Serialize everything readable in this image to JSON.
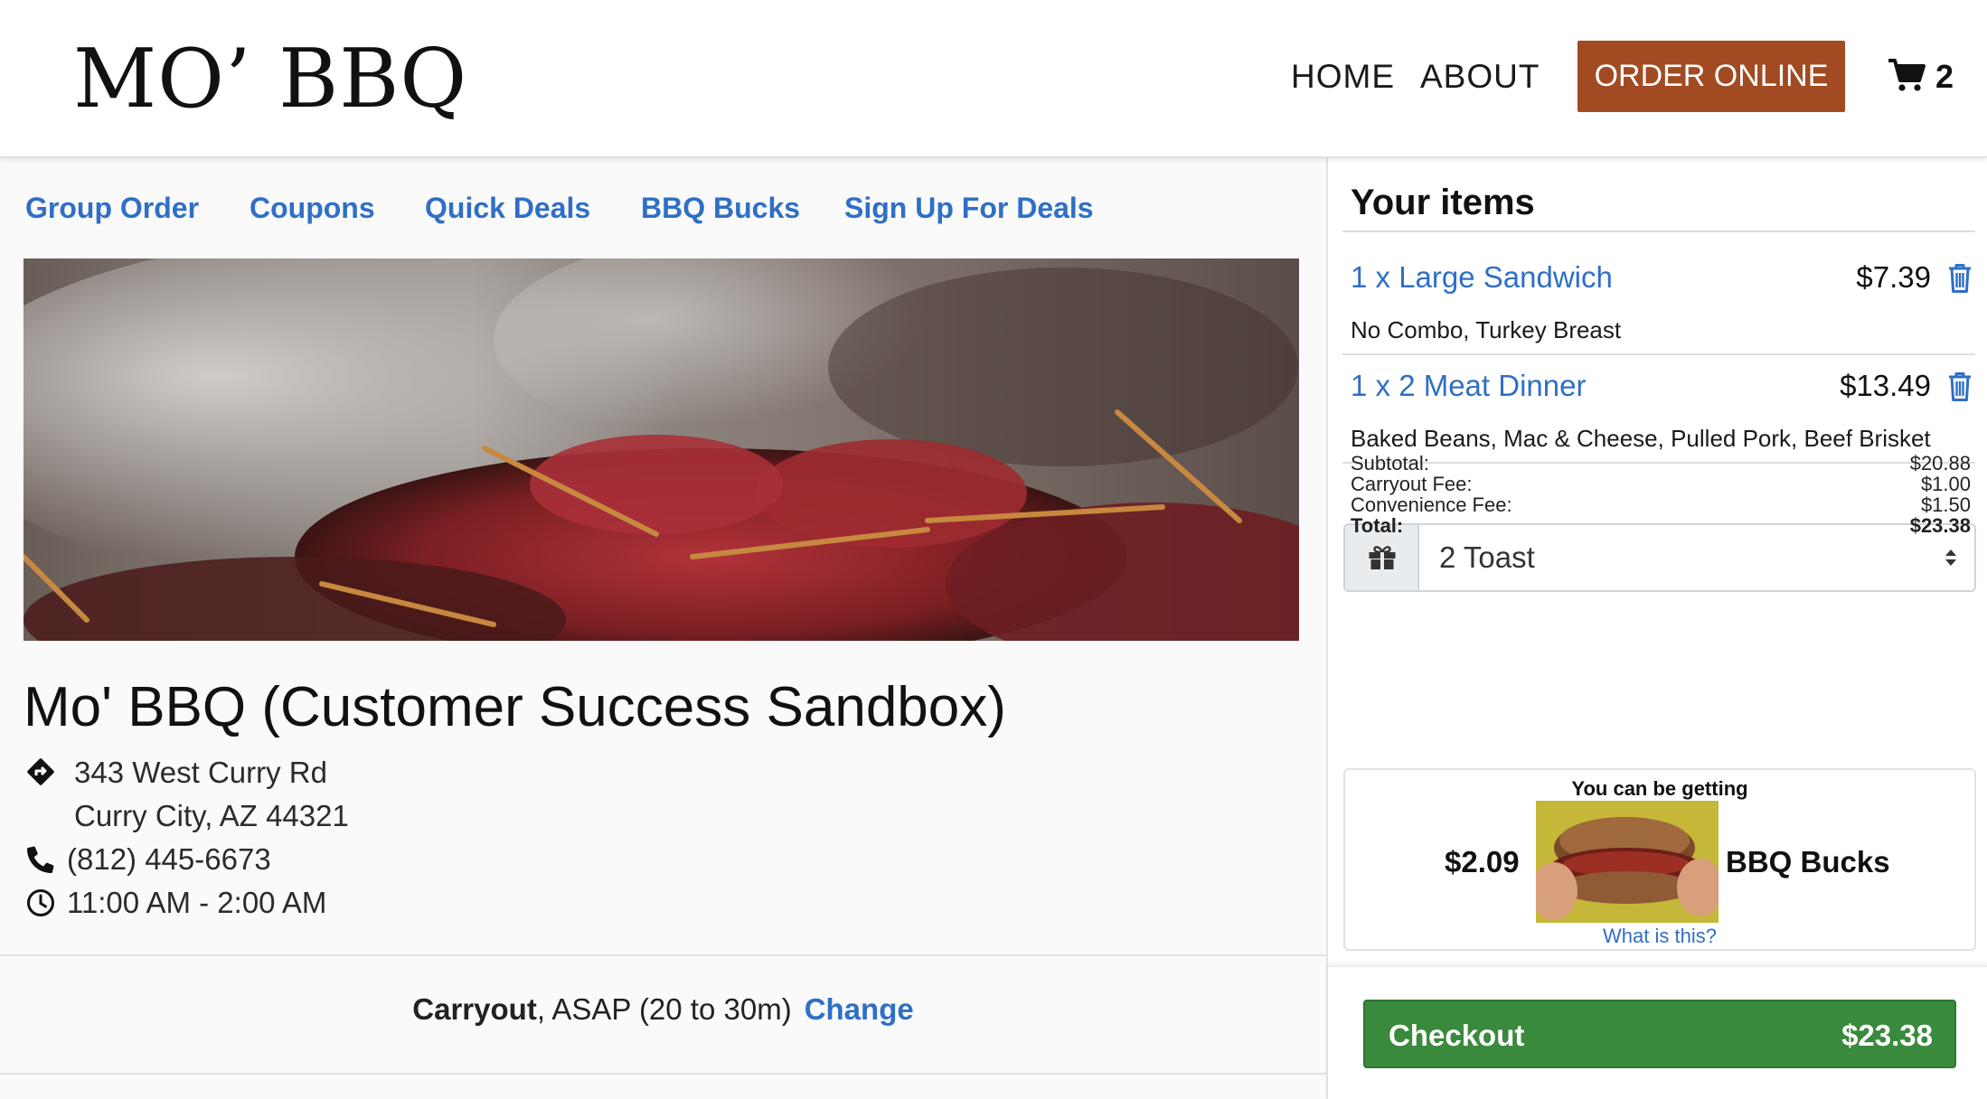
{
  "header": {
    "logo": "MO’ BBQ",
    "nav": {
      "home": "HOME",
      "about": "ABOUT",
      "order_online": "ORDER ONLINE"
    },
    "cart_count": "2"
  },
  "deals_nav": [
    "Group Order",
    "Coupons",
    "Quick Deals",
    "BBQ Bucks",
    "Sign Up For Deals"
  ],
  "store": {
    "title": "Mo' BBQ (Customer Success Sandbox)",
    "address_line1": "343 West Curry Rd",
    "address_line2": "Curry City, AZ 44321",
    "phone": "(812) 445-6673",
    "hours": "11:00 AM - 2:00 AM"
  },
  "order_mode": {
    "type": "Carryout",
    "timing": ", ASAP (20 to 30m)",
    "change_label": "Change"
  },
  "cart": {
    "title": "Your items",
    "items": [
      {
        "name": "1 x Large Sandwich",
        "price": "$7.39",
        "mods": "No Combo, Turkey Breast"
      },
      {
        "name": "1 x 2 Meat Dinner",
        "price": "$13.49",
        "mods": "Baked Beans, Mac & Cheese, Pulled Pork, Beef Brisket"
      }
    ],
    "gift_select": {
      "value": "2 Toast"
    },
    "totals": {
      "subtotal_label": "Subtotal:",
      "subtotal": "$20.88",
      "carryout_fee_label": "Carryout Fee:",
      "carryout_fee": "$1.00",
      "convenience_fee_label": "Convenience Fee:",
      "convenience_fee": "$1.50",
      "total_label": "Total:",
      "total": "$23.38"
    },
    "bucks": {
      "heading": "You can be getting",
      "amount": "$2.09",
      "label": "BBQ Bucks",
      "link": "What is this?"
    },
    "checkout": {
      "label": "Checkout",
      "total": "$23.38"
    }
  },
  "colors": {
    "brand_accent": "#a24a22",
    "link_blue": "#2f6fc6",
    "checkout_green": "#3a8a3d"
  },
  "icons": [
    "cart-icon",
    "trash-icon",
    "gift-icon",
    "directions-icon",
    "phone-icon",
    "clock-icon",
    "select-caret-icon"
  ]
}
